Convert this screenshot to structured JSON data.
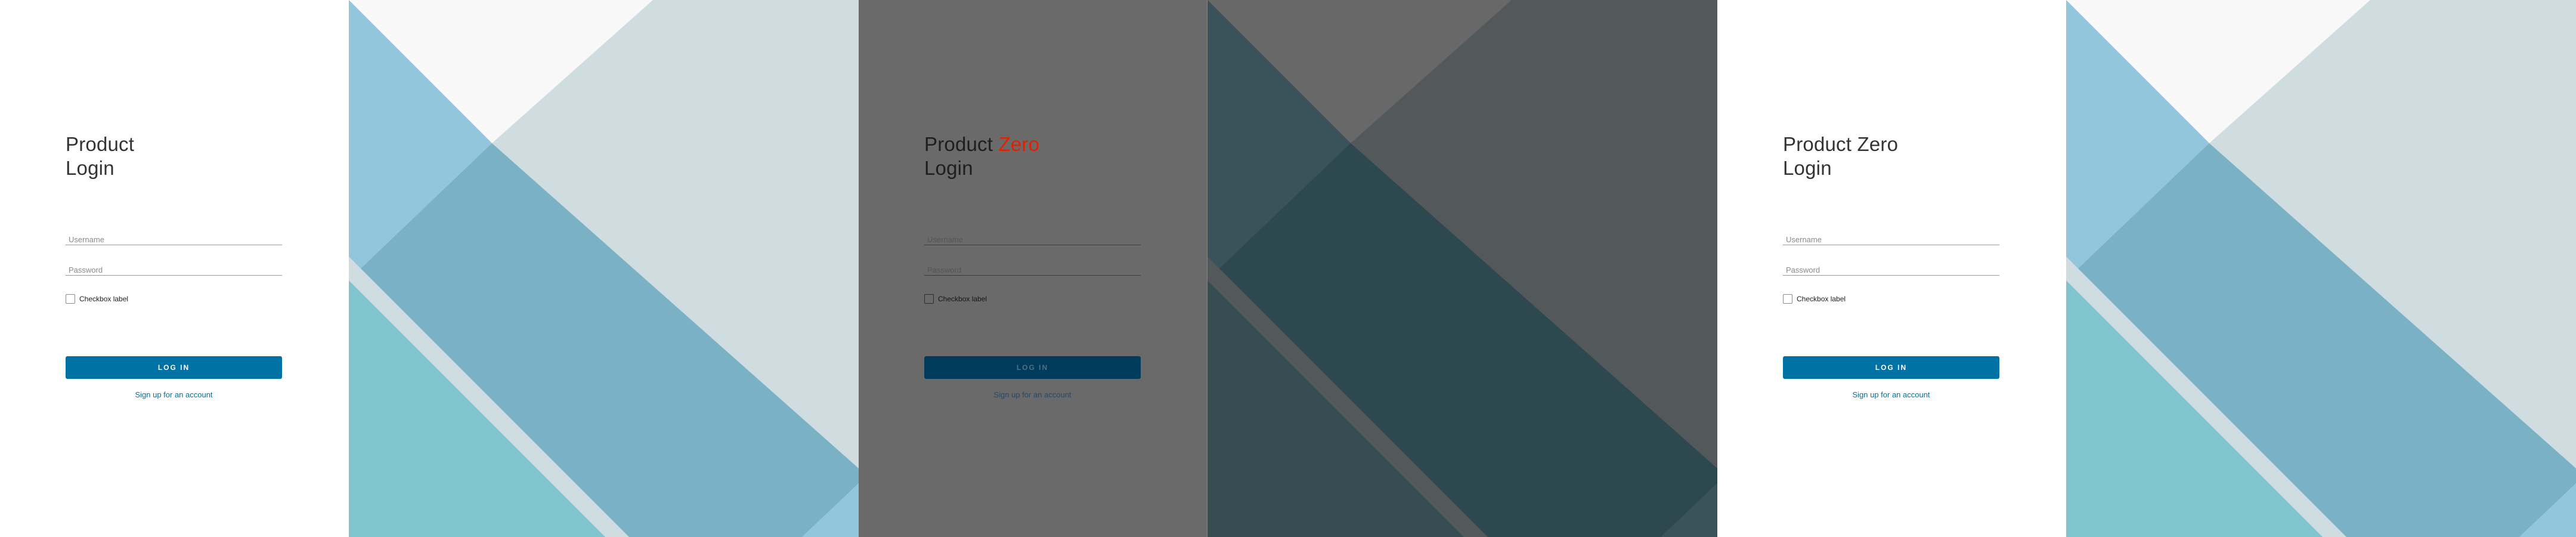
{
  "screens": [
    {
      "theme": "light",
      "title_line1": "Product",
      "title_accent": "",
      "title_line2": "Login",
      "username_placeholder": "Username",
      "password_placeholder": "Password",
      "checkbox_label": "Checkbox label",
      "login_label": "LOG IN",
      "signup_label": "Sign up for an account"
    },
    {
      "theme": "dark",
      "title_line1": "Product",
      "title_accent": "Zero",
      "title_line2": "Login",
      "username_placeholder": "Username",
      "password_placeholder": "Password",
      "checkbox_label": "Checkbox label",
      "login_label": "LOG IN",
      "signup_label": "Sign up for an account"
    },
    {
      "theme": "light",
      "title_line1": "Product Zero",
      "title_accent": "",
      "title_line2": "Login",
      "username_placeholder": "Username",
      "password_placeholder": "Password",
      "checkbox_label": "Checkbox label",
      "login_label": "LOG IN",
      "signup_label": "Sign up for an account"
    }
  ],
  "colors": {
    "primary": "#0072a3",
    "accent_red": "#e12200",
    "light_bg": {
      "base": "#cfdde1",
      "top": "#f8f8f8",
      "left_blue": "#93c6da",
      "mid_teal": "#7ab1c4",
      "low_cyan": "#80c4d0"
    },
    "dark_bg": {
      "base": "#53585b",
      "top": "#686868",
      "left_blue": "#3a525a",
      "mid_teal": "#2e4850",
      "low_cyan": "#364e51"
    }
  }
}
